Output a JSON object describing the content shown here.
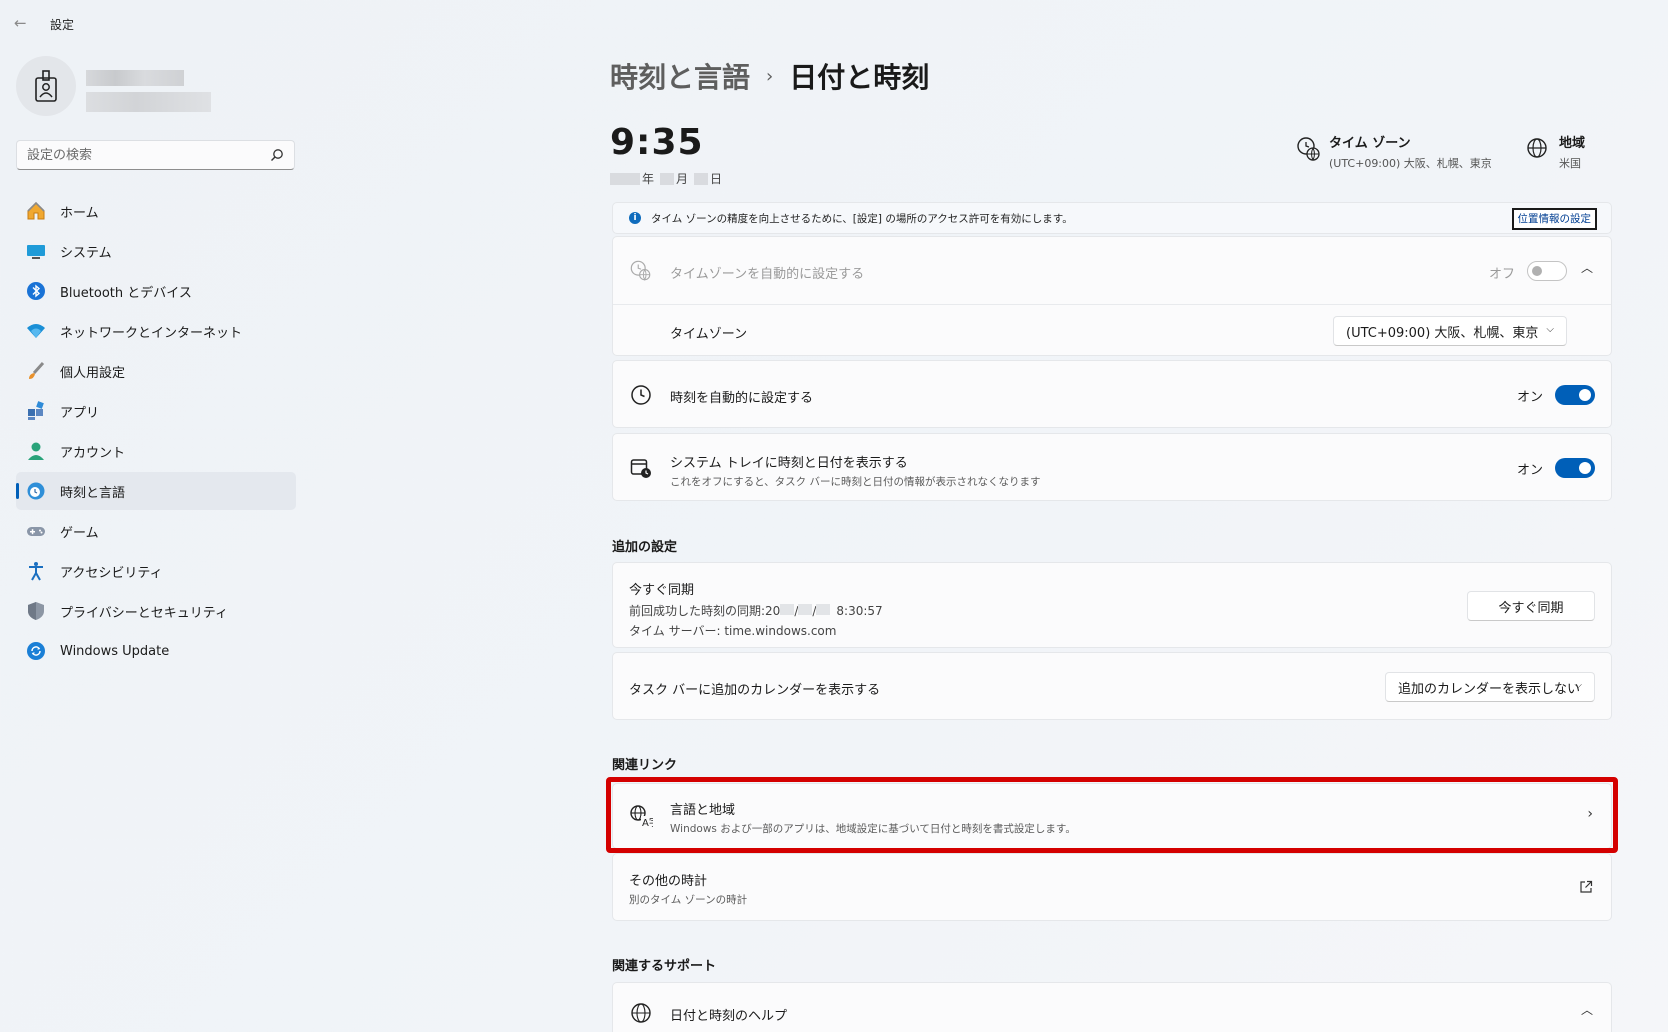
{
  "app": {
    "title": "設定",
    "back_label": "←"
  },
  "search": {
    "placeholder": "設定の検索"
  },
  "nav": {
    "items": [
      {
        "label": "ホーム"
      },
      {
        "label": "システム"
      },
      {
        "label": "Bluetooth とデバイス"
      },
      {
        "label": "ネットワークとインターネット"
      },
      {
        "label": "個人用設定"
      },
      {
        "label": "アプリ"
      },
      {
        "label": "アカウント"
      },
      {
        "label": "時刻と言語"
      },
      {
        "label": "ゲーム"
      },
      {
        "label": "アクセシビリティ"
      },
      {
        "label": "プライバシーとセキュリティ"
      },
      {
        "label": "Windows Update"
      }
    ],
    "active_index": 7
  },
  "breadcrumb": {
    "parent": "時刻と言語",
    "separator": "›",
    "current": "日付と時刻"
  },
  "clock": {
    "time": "9:35",
    "date_year_suffix": "年",
    "date_month_suffix": "月",
    "date_day_suffix": "日"
  },
  "timezone_info": {
    "label": "タイム ゾーン",
    "value": "(UTC+09:00) 大阪、札幌、東京"
  },
  "region_info": {
    "label": "地域",
    "value": "米国"
  },
  "info_bar": {
    "text": "タイム ゾーンの精度を向上させるために、[設定] の場所のアクセス許可を有効にします。",
    "link": "位置情報の設定"
  },
  "auto_timezone": {
    "title": "タイムゾーンを自動的に設定する",
    "state_label": "オフ",
    "state": false
  },
  "timezone": {
    "label": "タイムゾーン",
    "selected": "(UTC+09:00) 大阪、札幌、東京"
  },
  "auto_time": {
    "title": "時刻を自動的に設定する",
    "state_label": "オン",
    "state": true
  },
  "tray_time": {
    "title": "システム トレイに時刻と日付を表示する",
    "subtitle": "これをオフにすると、タスク バーに時刻と日付の情報が表示されなくなります",
    "state_label": "オン",
    "state": true
  },
  "additional_settings": {
    "heading": "追加の設定",
    "sync": {
      "title": "今すぐ同期",
      "last_sync_prefix": "前回成功した時刻の同期:20",
      "last_sync_sep1": "/",
      "last_sync_sep2": "/",
      "last_sync_time": "8:30:57",
      "server": "タイム サーバー: time.windows.com",
      "button": "今すぐ同期"
    },
    "calendar": {
      "title": "タスク バーに追加のカレンダーを表示する",
      "selected": "追加のカレンダーを表示しない"
    }
  },
  "related_links": {
    "heading": "関連リンク",
    "language_region": {
      "title": "言語と地域",
      "subtitle": "Windows および一部のアプリは、地域設定に基づいて日付と時刻を書式設定します。"
    },
    "other_clocks": {
      "title": "その他の時計",
      "subtitle": "別のタイム ゾーンの時計"
    }
  },
  "related_support": {
    "heading": "関連するサポート",
    "help": {
      "title": "日付と時刻のヘルプ"
    }
  },
  "colors": {
    "accent": "#005fb8",
    "highlight": "#d40000"
  }
}
